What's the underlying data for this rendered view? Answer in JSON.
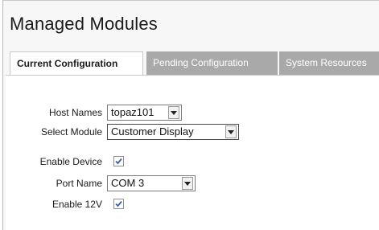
{
  "title": "Managed Modules",
  "tabs": [
    {
      "label": "Current Configuration",
      "active": true
    },
    {
      "label": "Pending Configuration",
      "active": false
    },
    {
      "label": "System Resources",
      "active": false
    }
  ],
  "form": {
    "host_names": {
      "label": "Host Names",
      "value": "topaz101"
    },
    "select_module": {
      "label": "Select Module",
      "value": "Customer Display"
    },
    "enable_device": {
      "label": "Enable Device",
      "checked": true
    },
    "port_name": {
      "label": "Port Name",
      "value": "COM 3"
    },
    "enable_12v": {
      "label": "Enable 12V",
      "checked": true
    }
  },
  "colors": {
    "tab_inactive_bg": "#a9a9a9",
    "checkmark": "#3a5fa8"
  }
}
